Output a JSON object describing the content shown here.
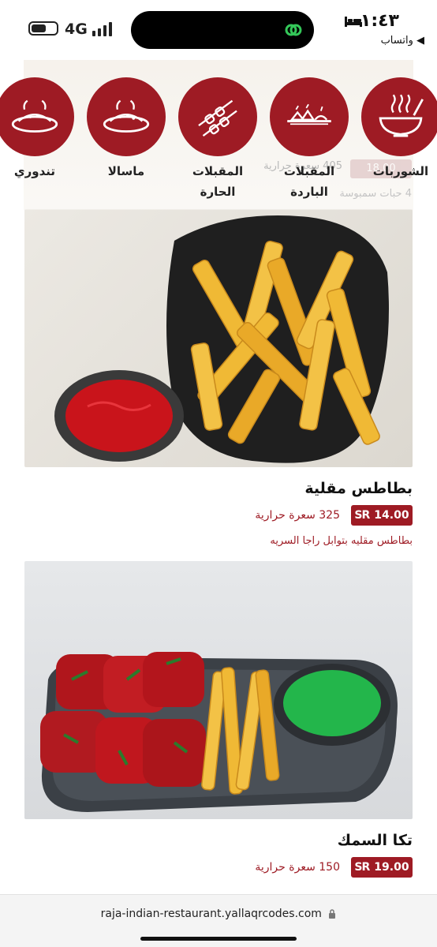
{
  "status": {
    "network": "4G",
    "time": "١:٤٣",
    "back_app": "◀ واتساب",
    "battery_level": 0.6
  },
  "categories": [
    {
      "label": "الشوربات",
      "icon": "soup-bowl-icon"
    },
    {
      "label": "المقبلات الباردة",
      "icon": "cold-appetizers-icon"
    },
    {
      "label": "المقبلات الحارة",
      "icon": "skewers-icon"
    },
    {
      "label": "ماسالا",
      "icon": "masala-dish-icon"
    },
    {
      "label": "تندوري",
      "icon": "tandoori-dish-icon"
    }
  ],
  "peek_item": {
    "price": "18.00",
    "calories": "405 سعرة حرارية",
    "description": "4 حبات سمبوسة"
  },
  "items": [
    {
      "name": "بطاطس مقلية",
      "price": "14.00",
      "calories": "325 سعرة حرارية",
      "description": "بطاطس مقليه بتوابل راجا السريه",
      "image": "french-fries-photo"
    },
    {
      "name": "تكا السمك",
      "price": "19.00",
      "calories": "150 سعرة حرارية",
      "image": "fish-tikka-photo"
    }
  ],
  "currency_symbol": "SR",
  "browser": {
    "url": "raja-indian-restaurant.yallaqrcodes.com"
  },
  "colors": {
    "accent": "#9e1b24"
  }
}
